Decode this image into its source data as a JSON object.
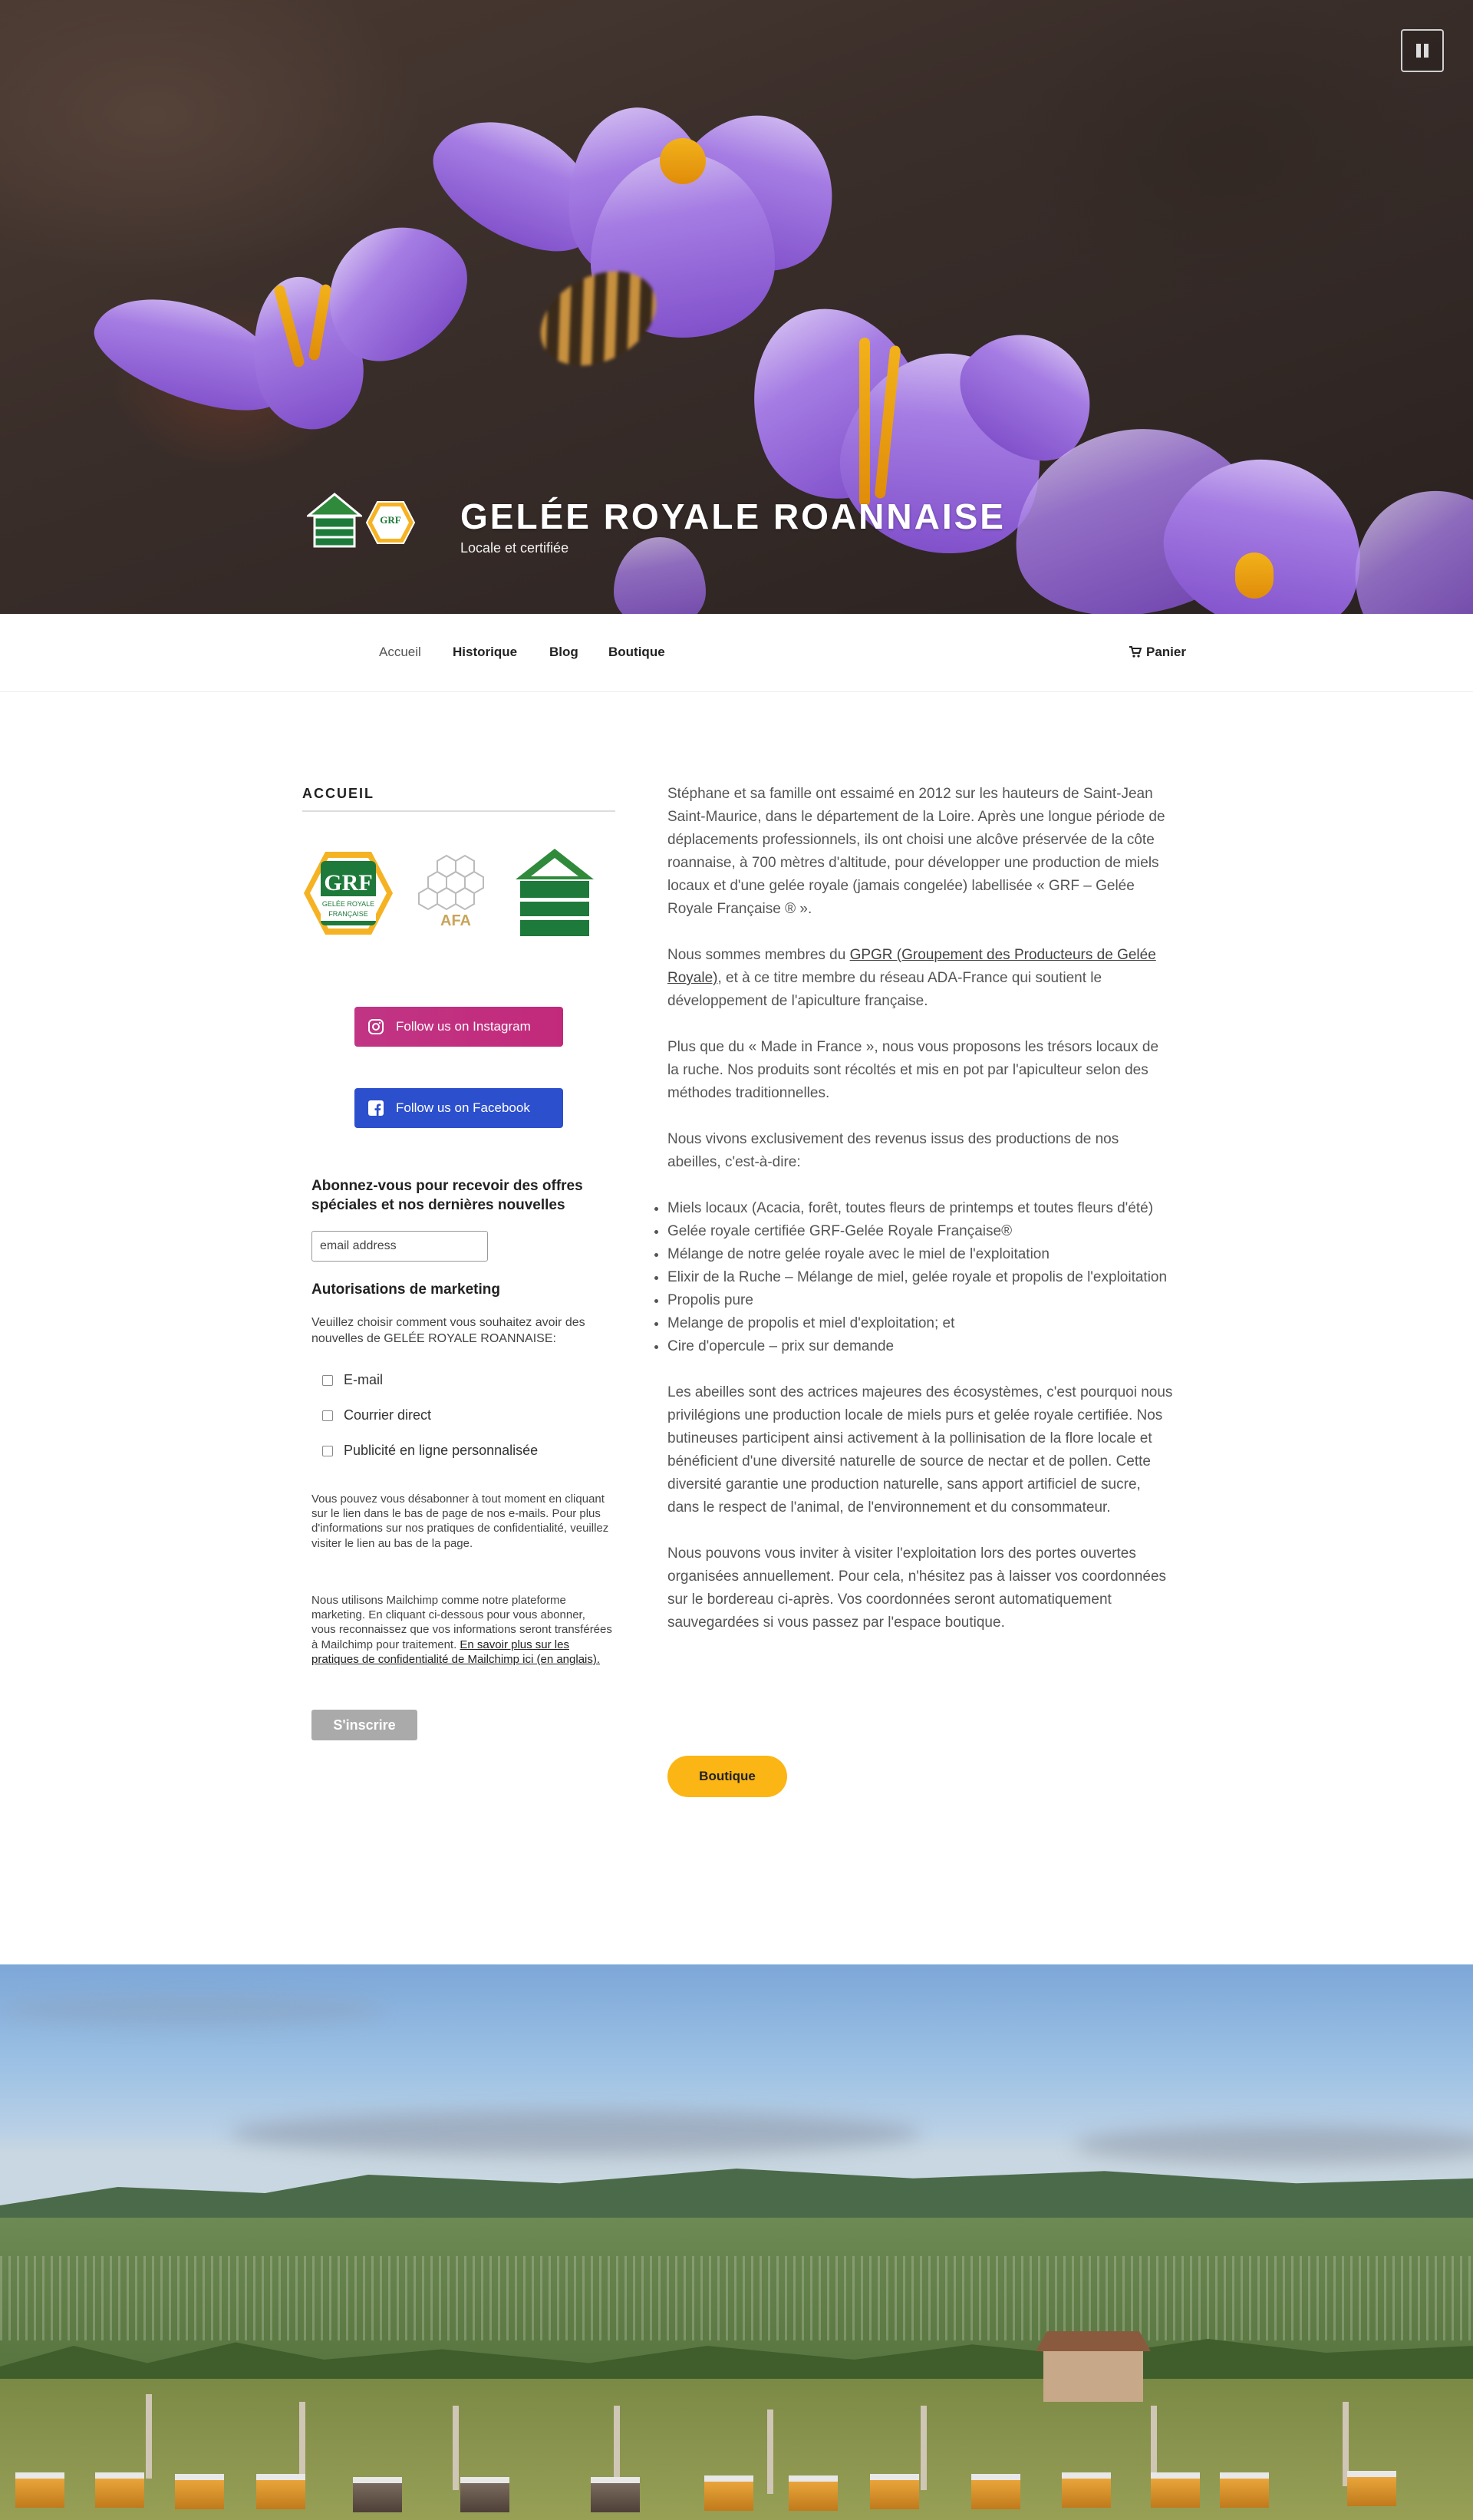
{
  "hero": {
    "site_title": "GELÉE ROYALE ROANNAISE",
    "tagline": "Locale et certifiée",
    "pause_icon": "pause-icon"
  },
  "nav": {
    "items": [
      {
        "label": "Accueil",
        "active": true
      },
      {
        "label": "Historique",
        "active": false
      },
      {
        "label": "Blog",
        "active": false
      },
      {
        "label": "Boutique",
        "active": false
      }
    ],
    "cart_label": "Panier",
    "cart_icon": "cart-icon"
  },
  "sidebar": {
    "title": "ACCUEIL",
    "logos": {
      "grf": {
        "top": "GRF",
        "line1": "GELÉE ROYALE",
        "line2": "FRANÇAISE"
      },
      "afa": "AFA",
      "hive": "hive-logo"
    },
    "instagram_label": "Follow us on Instagram",
    "facebook_label": "Follow us on Facebook",
    "newsletter": {
      "heading": "Abonnez-vous pour recevoir des offres spéciales et nos dernières nouvelles",
      "email_placeholder": "email address",
      "marketing_heading": "Autorisations de marketing",
      "marketing_desc": "Veuillez choisir comment vous souhaitez avoir des nouvelles de GELÉE ROYALE ROANNAISE:",
      "options": [
        "E-mail",
        "Courrier direct",
        "Publicité en ligne personnalisée"
      ],
      "unsubscribe_text": "Vous pouvez vous désabonner à tout moment en cliquant sur le lien dans le bas de page de nos e-mails. Pour plus d'informations sur nos pratiques de confidentialité, veuillez visiter le lien au bas de la page.",
      "mailchimp_text": "Nous utilisons Mailchimp comme notre plateforme marketing. En cliquant ci-dessous pour vous abonner, vous reconnaissez que vos informations seront transférées à Mailchimp pour traitement.",
      "mailchimp_link": "En savoir plus sur les pratiques de confidentialité de Mailchimp ici (en anglais).",
      "subscribe_label": "S'inscrire"
    }
  },
  "content": {
    "p1": "Stéphane et sa famille ont essaimé en 2012 sur les hauteurs de Saint-Jean Saint-Maurice, dans le département de la Loire. Après une longue période de déplacements professionnels, ils ont choisi une alcôve préservée de la côte roannaise, à 700 mètres d'altitude, pour développer une production de miels locaux et d'une gelée royale (jamais congelée) labellisée « GRF – Gelée Royale Française ® ».",
    "p2_before": "Nous sommes membres du ",
    "p2_link": "GPGR (Groupement des Producteurs de Gelée Royale)",
    "p2_after": ", et à ce titre membre du réseau ADA-France qui soutient le développement de l'apiculture française.",
    "p3": "Plus que du « Made in France », nous vous proposons les trésors locaux de la ruche. Nos produits sont récoltés et mis en pot par l'apiculteur selon des méthodes traditionnelles.",
    "p4": "Nous vivons exclusivement des revenus issus des productions de nos abeilles, c'est-à-dire:",
    "list": [
      "Miels locaux (Acacia, forêt, toutes fleurs de printemps et toutes fleurs d'été)",
      "Gelée royale certifiée GRF-Gelée Royale Française®",
      "Mélange de notre gelée royale avec le miel de l'exploitation",
      "Elixir de la Ruche – Mélange de miel, gelée royale et propolis de l'exploitation",
      "Propolis pure",
      "Melange de propolis et miel d'exploitation; et",
      "Cire d'opercule – prix sur demande"
    ],
    "p5": "Les abeilles sont des actrices majeures des écosystèmes, c'est pourquoi nous privilégions une production locale de miels purs et gelée royale certifiée. Nos butineuses participent ainsi activement à la pollinisation de la flore locale et bénéficient d'une diversité naturelle de source de nectar et de pollen. Cette diversité garantie une production naturelle, sans apport artificiel de sucre, dans le respect de l'animal, de l'environnement et du consommateur.",
    "p6": "Nous pouvons vous inviter à visiter l'exploitation lors des portes ouvertes organisées annuellement. Pour cela, n'hésitez pas à laisser vos coordonnées sur le bordereau ci-après. Vos coordonnées seront automatiquement sauvegardées si vous passez par l'espace boutique.",
    "boutique_button": "Boutique"
  },
  "colors": {
    "accent_yellow": "#fbb514",
    "instagram": "#c13584",
    "facebook": "#2c4fcd",
    "grf_green": "#1e7a3a"
  }
}
